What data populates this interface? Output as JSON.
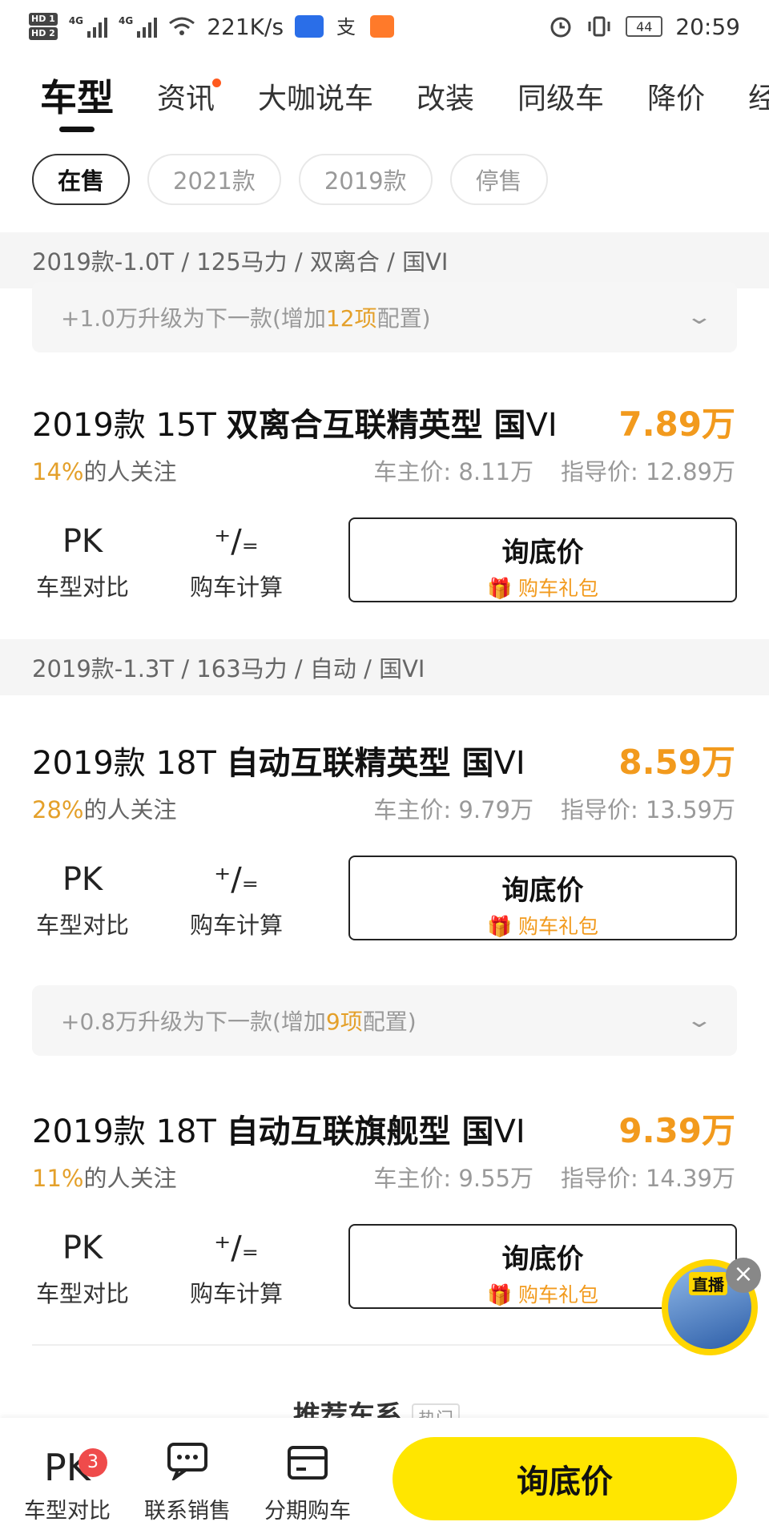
{
  "status_bar": {
    "network_speed": "221K/s",
    "network_type": "4G",
    "time": "20:59",
    "battery": "44",
    "hd1": "HD 1",
    "hd2": "HD 2"
  },
  "tabs": [
    "车型",
    "资讯",
    "大咖说车",
    "改装",
    "同级车",
    "降价",
    "经"
  ],
  "filters": [
    "在售",
    "2021款",
    "2019款",
    "停售"
  ],
  "groups": [
    {
      "spec": "2019款-1.0T / 125马力 / 双离合 / 国VI"
    },
    {
      "spec": "2019款-1.3T / 163马力 / 自动 / 国VI"
    }
  ],
  "upgrade_banners": [
    {
      "prefix": "+1.0万升级为下一款(增加",
      "count": "12项",
      "suffix": "配置)"
    },
    {
      "prefix": "+0.8万升级为下一款(增加",
      "count": "9项",
      "suffix": "配置)"
    }
  ],
  "models": [
    {
      "year": "2019款 15T",
      "name": "双离合互联精英型 国",
      "roman": "VI",
      "price": "7.89万",
      "attention_pct": "14%",
      "attention_text": "的人关注",
      "owner_price": "车主价: 8.11万",
      "guide_price": "指导价: 12.89万"
    },
    {
      "year": "2019款 18T",
      "name": "自动互联精英型 国",
      "roman": "VI",
      "price": "8.59万",
      "attention_pct": "28%",
      "attention_text": "的人关注",
      "owner_price": "车主价: 9.79万",
      "guide_price": "指导价: 13.59万"
    },
    {
      "year": "2019款 18T",
      "name": "自动互联旗舰型 国",
      "roman": "VI",
      "price": "9.39万",
      "attention_pct": "11%",
      "attention_text": "的人关注",
      "owner_price": "车主价: 9.55万",
      "guide_price": "指导价: 14.39万"
    }
  ],
  "actions": {
    "compare_icon": "PK",
    "compare_label": "车型对比",
    "calc_icon": "calculator-icon",
    "calc_label": "购车计算",
    "ask_label": "询底价",
    "gift_label": "购车礼包"
  },
  "recommend": {
    "title": "推荐车系",
    "tag": "热门"
  },
  "live": {
    "label": "直播"
  },
  "bottom_bar": {
    "compare_icon": "PK",
    "compare_label": "车型对比",
    "compare_badge": "3",
    "contact_label": "联系销售",
    "installment_label": "分期购车",
    "cta_label": "询底价"
  },
  "colors": {
    "accent_orange": "#f29a1d",
    "cta_yellow": "#ffe600"
  }
}
